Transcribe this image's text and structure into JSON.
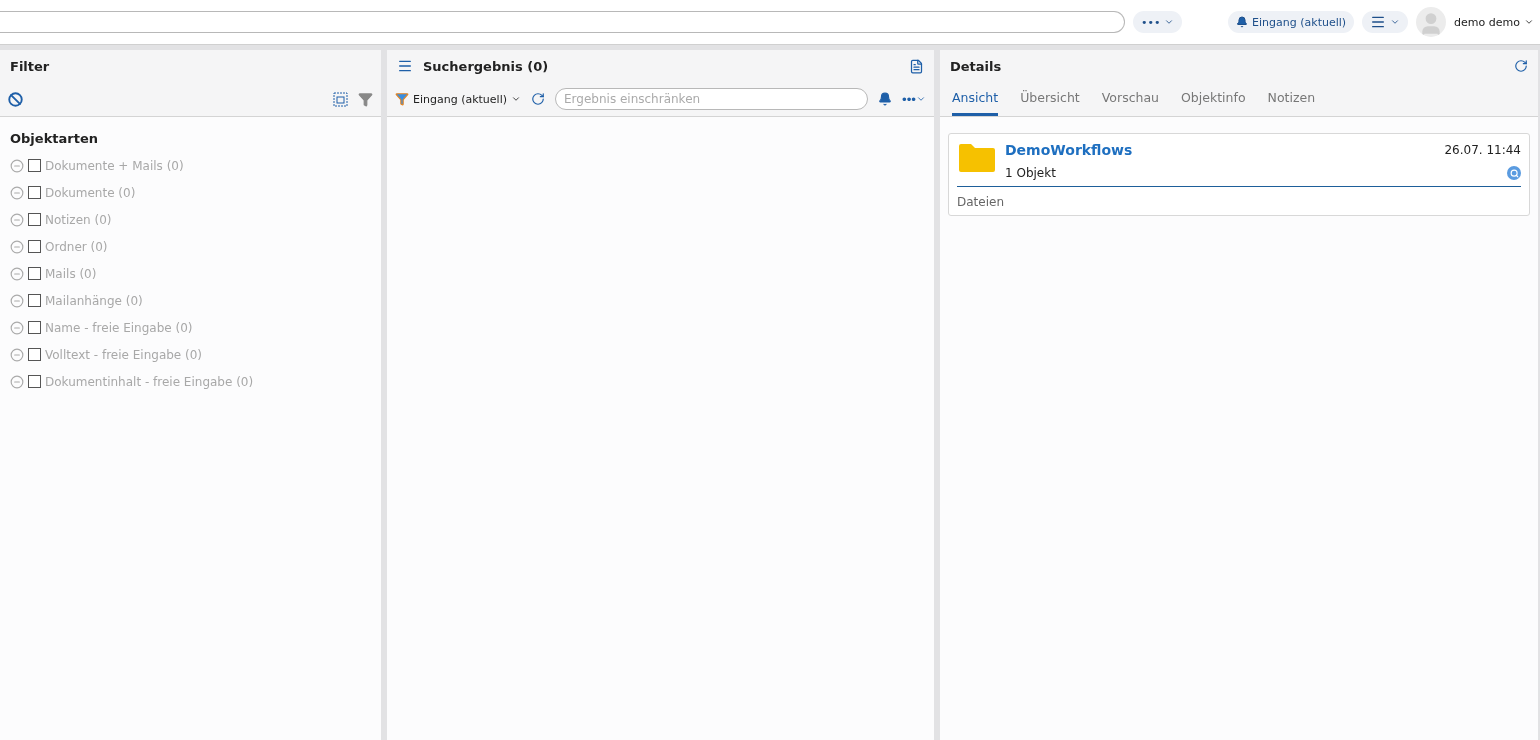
{
  "topbar": {
    "more_label": "•••",
    "notification": "Eingang (aktuell)",
    "user": "demo demo"
  },
  "filter": {
    "title": "Filter",
    "section": "Objektarten",
    "items": [
      {
        "label": "Dokumente + Mails (0)",
        "checked": false
      },
      {
        "label": "Dokumente (0)",
        "checked": false
      },
      {
        "label": "Notizen (0)",
        "checked": false
      },
      {
        "label": "Ordner (0)",
        "checked": false
      },
      {
        "label": "Mails (0)",
        "checked": false
      },
      {
        "label": "Mailanhänge (0)",
        "checked": false
      },
      {
        "label": "Name - freie Eingabe (0)",
        "checked": false
      },
      {
        "label": "Volltext - freie Eingabe (0)",
        "checked": false
      },
      {
        "label": "Dokumentinhalt - freie Eingabe (0)",
        "checked": false
      }
    ]
  },
  "results": {
    "title": "Suchergebnis (0)",
    "source": "Eingang (aktuell)",
    "search": {
      "placeholder": "Ergebnis einschränken"
    },
    "more_label": "•••"
  },
  "details": {
    "title": "Details",
    "tabs": [
      {
        "label": "Ansicht",
        "selected": true
      },
      {
        "label": "Übersicht",
        "selected": false
      },
      {
        "label": "Vorschau",
        "selected": false
      },
      {
        "label": "Objektinfo",
        "selected": false
      },
      {
        "label": "Notizen",
        "selected": false
      }
    ],
    "card": {
      "name": "DemoWorkflows",
      "date": "26.07. 11:44",
      "count": "1 Objekt",
      "section": "Dateien"
    }
  }
}
